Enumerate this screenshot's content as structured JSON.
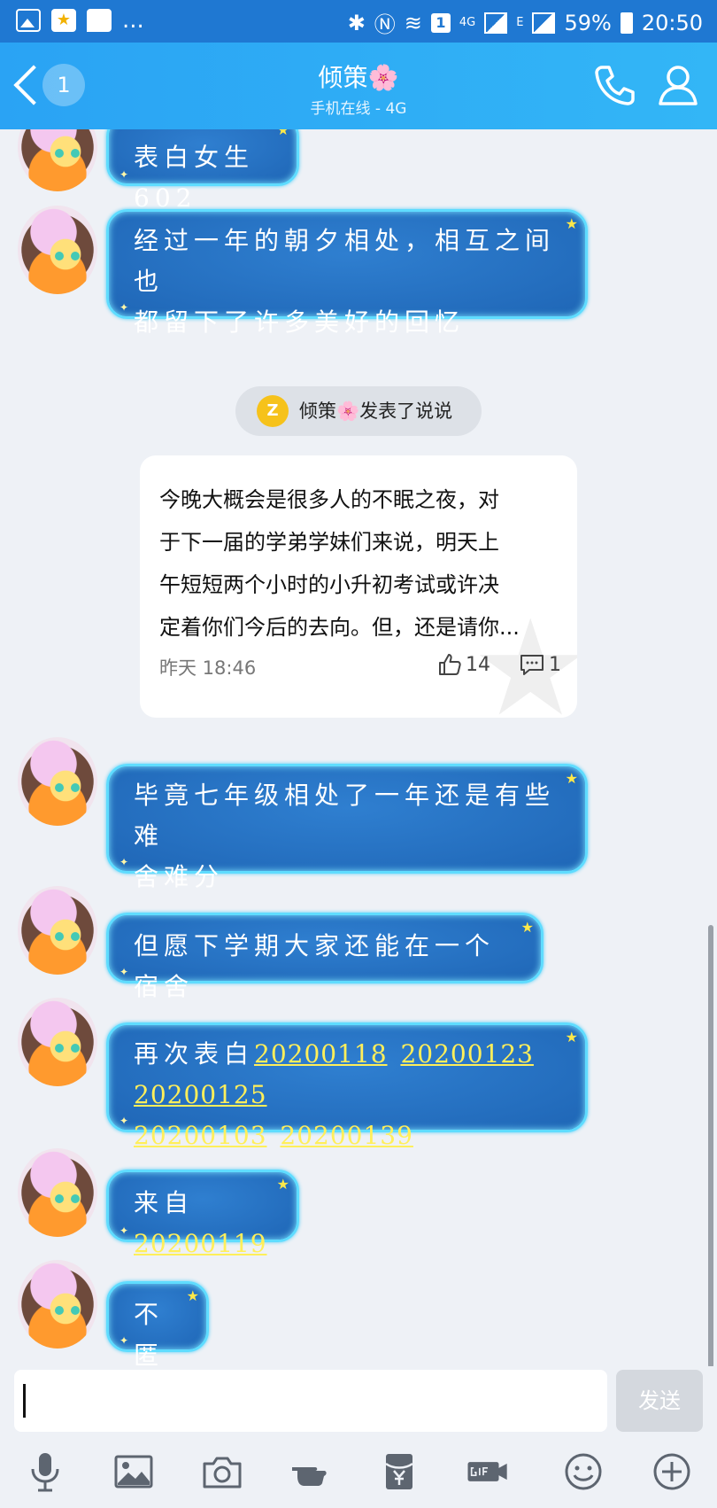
{
  "status_bar": {
    "dots": "...",
    "network": "4G",
    "network2": "E",
    "sim_badge": "1",
    "battery": "59%",
    "time": "20:50"
  },
  "header": {
    "unread_count": "1",
    "contact_name": "倾策",
    "contact_flower": "🌸",
    "status": "手机在线 - 4G"
  },
  "messages": [
    {
      "text": "表白女生602"
    },
    {
      "text_lines": [
        "经过一年的朝夕相处，相互之间也",
        "都留下了许多美好的回忆"
      ]
    },
    {
      "text_lines": [
        "毕竟七年级相处了一年还是有些难",
        "舍难分"
      ]
    },
    {
      "text": "但愿下学期大家还能在一个宿舍"
    },
    {
      "prefix": "再次表白",
      "links": [
        "20200118",
        "20200123",
        "20200125",
        "20200103",
        "20200139"
      ]
    },
    {
      "prefix": "来自",
      "links": [
        "20200119"
      ]
    },
    {
      "text": "不匿"
    }
  ],
  "system_message": {
    "icon_text": "Z",
    "name": "倾策",
    "flower": "🌸",
    "action": "发表了说说"
  },
  "post_card": {
    "lines": [
      "今晚大概会是很多人的不眠之夜，对",
      "于下一届的学弟学妹们来说，明天上",
      "午短短两个小时的小升初考试或许决",
      "定着你们今后的去向。但，还是请你..."
    ],
    "time": "昨天 18:46",
    "likes": "14",
    "comments": "1"
  },
  "composer": {
    "send_label": "发送"
  },
  "colors": {
    "header_blue": "#2aa3f4",
    "status_blue": "#1f78d2",
    "bubble_blue": "#1f66b6",
    "bubble_glow": "#5fdcff",
    "link_yellow": "#ffef5a"
  }
}
